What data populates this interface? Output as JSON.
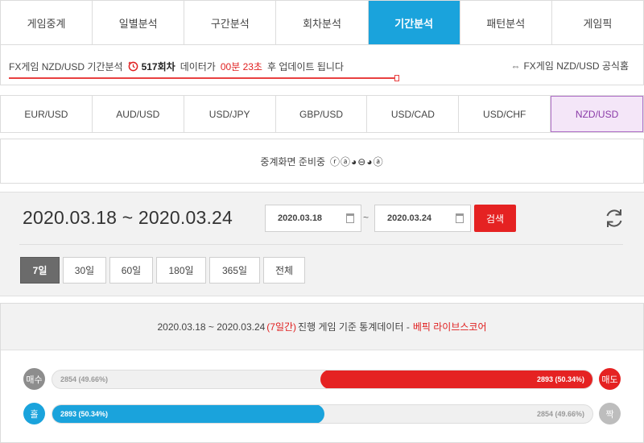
{
  "nav": {
    "tabs": [
      {
        "label": "게임중계",
        "active": false
      },
      {
        "label": "일별분석",
        "active": false
      },
      {
        "label": "구간분석",
        "active": false
      },
      {
        "label": "회차분석",
        "active": false
      },
      {
        "label": "기간분석",
        "active": true
      },
      {
        "label": "패턴분석",
        "active": false
      },
      {
        "label": "게임픽",
        "active": false
      }
    ]
  },
  "notice": {
    "prefix": "FX게임 NZD/USD 기간분석",
    "round": "517회차",
    "middle": "데이터가",
    "time": "00분 23초",
    "suffix": "후 업데이트 됩니다",
    "progress": 0.615,
    "official_link": "FX게임 NZD/USD 공식홈"
  },
  "pairs": [
    {
      "label": "EUR/USD",
      "active": false
    },
    {
      "label": "AUD/USD",
      "active": false
    },
    {
      "label": "USD/JPY",
      "active": false
    },
    {
      "label": "GBP/USD",
      "active": false
    },
    {
      "label": "USD/CAD",
      "active": false
    },
    {
      "label": "USD/CHF",
      "active": false
    },
    {
      "label": "NZD/USD",
      "active": true
    }
  ],
  "relay": {
    "text": "중계화면 준비중",
    "dots": "ⓡⓐ◕⊖◕ⓐ"
  },
  "period": {
    "title": "2020.03.18 ~ 2020.03.24",
    "start_date": "2020.03.18",
    "end_date": "2020.03.24",
    "tilde": "~",
    "search_label": "검색",
    "ranges": [
      {
        "label": "7일",
        "active": true
      },
      {
        "label": "30일",
        "active": false
      },
      {
        "label": "60일",
        "active": false
      },
      {
        "label": "180일",
        "active": false
      },
      {
        "label": "365일",
        "active": false
      },
      {
        "label": "전체",
        "active": false
      }
    ]
  },
  "stats": {
    "range": "2020.03.18 ~ 2020.03.24",
    "days": "(7일간)",
    "desc": "진행 게임 기준 통계데이터 -",
    "brand": "베픽 라이브스코어",
    "rows": [
      {
        "left_label": "매수",
        "right_label": "매도",
        "left_value": "2854 (49.66%)",
        "right_value": "2893 (50.34%)",
        "winner": "right",
        "fill_ratio": 0.5034,
        "colors": {
          "left": "#8d8d8d",
          "right": "#e52222",
          "fill": "#e52222"
        }
      },
      {
        "left_label": "홀",
        "right_label": "짝",
        "left_value": "2893 (50.34%)",
        "right_value": "2854 (49.66%)",
        "winner": "left",
        "fill_ratio": 0.5034,
        "colors": {
          "left": "#1aa3dc",
          "right": "#bdbdbd",
          "fill": "#1aa3dc"
        }
      }
    ]
  },
  "colors": {
    "active_tab": "#1aa3dc",
    "accent_red": "#e52222",
    "active_pair_bg": "#f4e6f8",
    "active_pair_border": "#b070c8"
  }
}
